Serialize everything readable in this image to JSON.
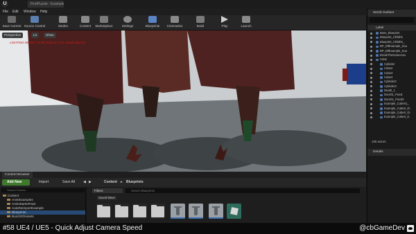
{
  "window": {
    "app_logo": "U",
    "document_tab": "FirstPuzzle - ExampleMap"
  },
  "menu": {
    "items": [
      "File",
      "Edit",
      "Window",
      "Help"
    ]
  },
  "toolbar": {
    "buttons": [
      {
        "label": "Save Current",
        "icon": "save-icon",
        "color": "#6b6b6b"
      },
      {
        "label": "Source Control",
        "icon": "source-control-icon",
        "color": "#5a7fb0"
      },
      {
        "label": "Modes",
        "icon": "modes-icon",
        "color": "#8a8a8a"
      },
      {
        "label": "Content",
        "icon": "content-icon",
        "color": "#8a8a8a"
      },
      {
        "label": "Marketplace",
        "icon": "marketplace-icon",
        "color": "#7a7a7a"
      },
      {
        "label": "Settings",
        "icon": "settings-gear-icon",
        "color": "#8a8a8a"
      },
      {
        "label": "Blueprints",
        "icon": "blueprints-icon",
        "color": "#5b84c4"
      },
      {
        "label": "Cinematics",
        "icon": "cinematics-icon",
        "color": "#8a8a8a"
      },
      {
        "label": "Build",
        "icon": "build-icon",
        "color": "#7a7a7a"
      },
      {
        "label": "Play",
        "icon": "play-icon",
        "color": "#cfcfcf"
      },
      {
        "label": "Launch",
        "icon": "launch-icon",
        "color": "#8a8a8a"
      }
    ]
  },
  "viewport": {
    "chips": [
      "Perspective",
      "Lit",
      "Show"
    ],
    "warning": "LIGHTING NEEDS TO BE REBUILT (10 unbuilt objects)"
  },
  "world_outliner": {
    "tab_label": "World Outliner",
    "column_label": "Label",
    "items": [
      {
        "label": "Base_Blueprint",
        "indent": 0
      },
      {
        "label": "Blueprint_Child01",
        "indent": 0
      },
      {
        "label": "Blueprint_Child01_",
        "indent": 0
      },
      {
        "label": "BP_DifExample_Sou",
        "indent": 0
      },
      {
        "label": "BP_DifExample_Sou",
        "indent": 0
      },
      {
        "label": "BreakTheGameAsa",
        "indent": 0
      },
      {
        "label": "Cube",
        "indent": 0
      },
      {
        "label": "Cylinder",
        "indent": 1
      },
      {
        "label": "Cube2",
        "indent": 1
      },
      {
        "label": "Cube3",
        "indent": 1
      },
      {
        "label": "Cube4",
        "indent": 1
      },
      {
        "label": "Cylinder2",
        "indent": 1
      },
      {
        "label": "Cylinder3",
        "indent": 1
      },
      {
        "label": "Death_1",
        "indent": 1
      },
      {
        "label": "Door01_Fixed",
        "indent": 1
      },
      {
        "label": "Door01_Fixed2",
        "indent": 1
      },
      {
        "label": "Example_Cube01_",
        "indent": 1
      },
      {
        "label": "Example_Cube0_Gi",
        "indent": 1
      },
      {
        "label": "Example_Cube0_Gi",
        "indent": 1
      },
      {
        "label": "Example_Cube0_G",
        "indent": 1
      }
    ],
    "actor_count": "106 actors"
  },
  "details": {
    "tab_label": "Details"
  },
  "content_browser": {
    "tab_label": "Content Browser",
    "add_new": "Add New",
    "import": "Import",
    "save_all": "Save All",
    "breadcrumb": [
      "Content",
      "Blueprints"
    ],
    "folder_search_placeholder": "Search Folders",
    "folders": [
      {
        "label": "Content",
        "selected": false,
        "indent": 0
      },
      {
        "label": "AnimExamples",
        "selected": false,
        "indent": 1
      },
      {
        "label": "AnimStarterPack",
        "selected": false,
        "indent": 1
      },
      {
        "label": "AutoReimportExample",
        "selected": false,
        "indent": 1
      },
      {
        "label": "Blueprints",
        "selected": true,
        "indent": 1
      },
      {
        "label": "BunchOfAssets",
        "selected": false,
        "indent": 1
      }
    ],
    "filters_label": "Filters",
    "asset_search_placeholder": "Search Blueprints",
    "sound_wave_label": "Sound Wave"
  },
  "caption": {
    "title": "#58 UE4 / UE5 - Quick Adjust Camera Speed",
    "handle": "@cbGameDev",
    "bird_icon": "twitter-bird-icon"
  },
  "colors": {
    "selection": "#264a73",
    "add_new_green": "#3f7a2c",
    "warning_red": "#c81a1a"
  }
}
